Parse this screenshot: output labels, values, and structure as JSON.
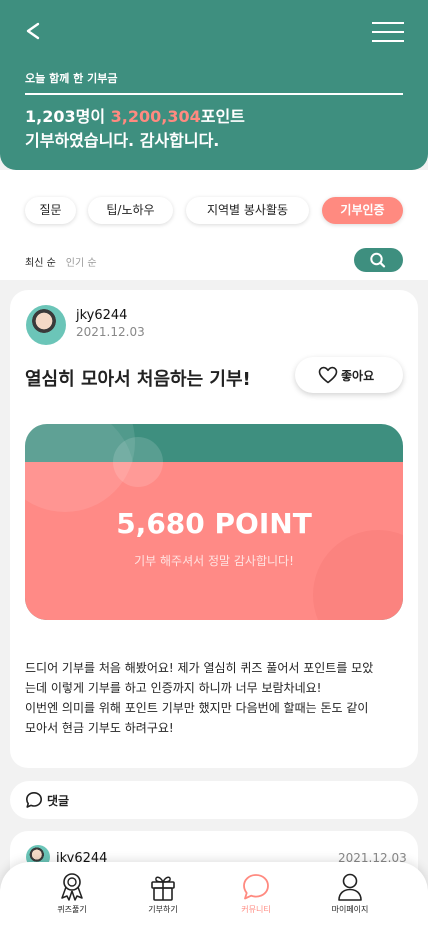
{
  "header": {
    "back_icon": "chevron-left-icon",
    "menu_icon": "hamburger-menu-icon",
    "caption": "오늘 함께 한 기부금",
    "donor_count": "1,203명이",
    "points_total": "3,200,304",
    "points_suffix": "포인트",
    "thanks_line": "기부하였습니다. 감사합니다."
  },
  "tabs": [
    {
      "label": "질문"
    },
    {
      "label": "팁/노하우"
    },
    {
      "label": "지역별 봉사활동"
    },
    {
      "label": "기부인증",
      "active": true
    }
  ],
  "sort": {
    "latest": "최신 순",
    "popular": "인기 순",
    "search_icon": "search-icon"
  },
  "post": {
    "author": "jky6244",
    "date": "2021.12.03",
    "title": "열심히 모아서 처음하는 기부!",
    "like_label": "좋아요",
    "point_value": "5,680 POINT",
    "point_thanks": "기부 해주셔서 정말 감사합니다!",
    "body_lines": [
      "드디어 기부를 처음 해봤어요! 제가 열심히 퀴즈 풀어서 포인트를 모았",
      "는데 이렇게 기부를 하고 인증까지 하니까 너무 보람차네요!",
      "이번엔 의미를 위해 포인트 기부만 했지만 다음번에 할때는 돈도 같이",
      "모아서 현금 기부도 하려구요!"
    ]
  },
  "comments": {
    "label": "댓글",
    "icon": "speech-bubble-icon"
  },
  "post2": {
    "author": "jky6244",
    "date": "2021.12.03"
  },
  "bottom_nav": [
    {
      "label": "퀴즈풀기",
      "icon": "medal-icon"
    },
    {
      "label": "기부하기",
      "icon": "gift-icon"
    },
    {
      "label": "커뮤니티",
      "icon": "speech-bubble-icon",
      "active": true
    },
    {
      "label": "마이페이지",
      "icon": "user-icon"
    }
  ],
  "colors": {
    "brand_green": "#3e8f7f",
    "accent_coral": "#ff8a80"
  }
}
